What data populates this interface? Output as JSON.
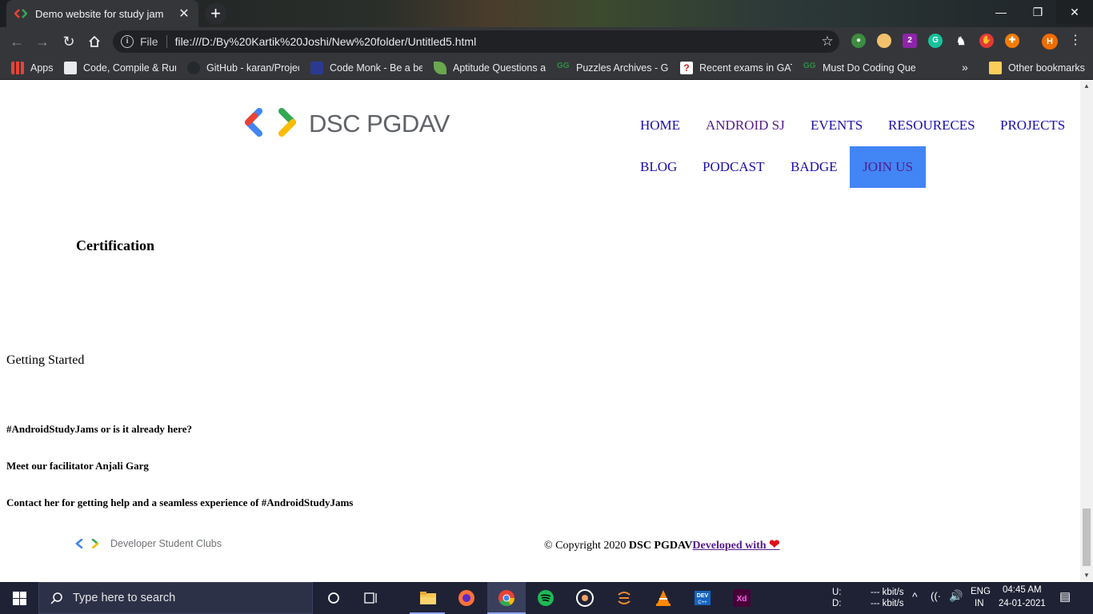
{
  "browser": {
    "tab_title": "Demo website for study jam",
    "tab_close": "✕",
    "new_tab": "+",
    "omnibox": {
      "scheme_label": "File",
      "url": "file:///D:/By%20Kartik%20Joshi/New%20folder/Untitled5.html"
    },
    "profile_initial": "H",
    "bookmarks": [
      {
        "label": "Apps",
        "icon_color": "#ea4335"
      },
      {
        "label": "Code, Compile & Run",
        "icon_color": "#5f6368"
      },
      {
        "label": "GitHub - karan/Projects",
        "icon_color": "#24292e"
      },
      {
        "label": "Code Monk - Be a be",
        "icon_color": "#2b3a8f"
      },
      {
        "label": "Aptitude Questions an",
        "icon_color": "#6aa84f"
      },
      {
        "label": "Puzzles Archives - Ge",
        "icon_color": "#2f8d46"
      },
      {
        "label": "Recent exams in GATE",
        "icon_color": "#cc2222"
      },
      {
        "label": "Must Do Coding Ques",
        "icon_color": "#2f8d46"
      }
    ],
    "bookmarks_more": "»",
    "other_bookmarks": "Other bookmarks"
  },
  "site": {
    "logo_text": "DSC PGDAV",
    "nav": [
      {
        "label": "HOME",
        "visited": false
      },
      {
        "label": "ANDROID SJ",
        "visited": true
      },
      {
        "label": "EVENTS",
        "visited": false
      },
      {
        "label": "RESOURECES",
        "visited": false
      },
      {
        "label": "PROJECTS",
        "visited": false
      },
      {
        "label": "BLOG",
        "visited": false
      },
      {
        "label": "PODCAST",
        "visited": false
      },
      {
        "label": "BADGE",
        "visited": false
      }
    ],
    "join_label": "JOIN US",
    "join_color": "#4285f4",
    "certification_heading": "Certification",
    "getting_started": "Getting Started",
    "paragraphs": [
      "#AndroidStudyJams or is it already here?",
      "Meet our facilitator Anjali Garg",
      "Contact her for getting help and a seamless experience of #AndroidStudyJams"
    ],
    "footer": {
      "logo_text": "Developer Student Clubs",
      "copyright_prefix": "© Copyright 2020",
      "copyright_org": "DSC PGDAV",
      "developed_with": "Developed with",
      "heart_icon": "❤"
    }
  },
  "taskbar": {
    "search_placeholder": "Type here to search",
    "net_up_label": "U:",
    "net_down_label": "D:",
    "net_up_value": "--- kbit/s",
    "net_down_value": "--- kbit/s",
    "language": "ENG",
    "region": "IN",
    "time": "04:45 AM",
    "date": "24-01-2021"
  }
}
